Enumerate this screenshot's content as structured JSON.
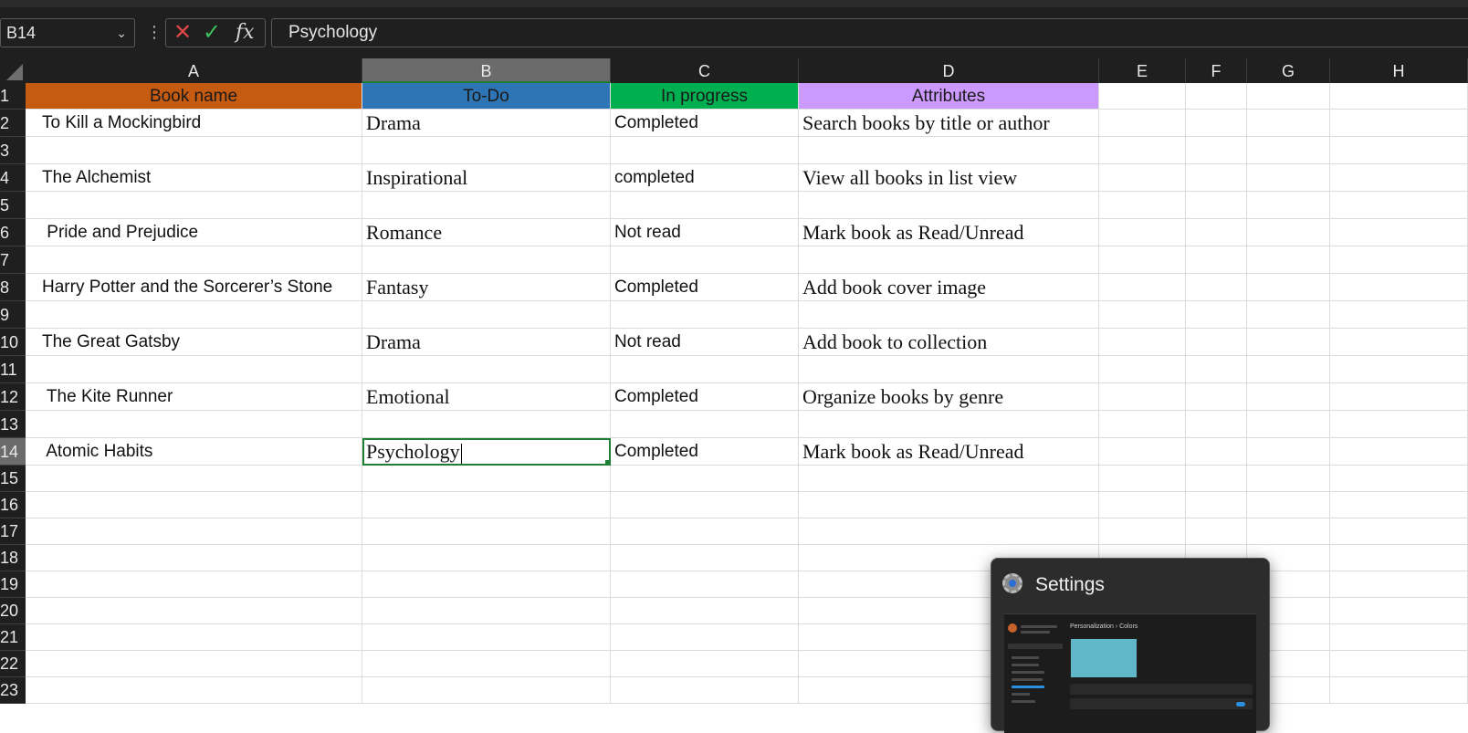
{
  "formula_bar": {
    "name_box": "B14",
    "formula": "Psychology",
    "cancel_icon": "x-icon",
    "enter_icon": "check-icon",
    "function_label": "fx"
  },
  "columns": [
    "A",
    "B",
    "C",
    "D",
    "E",
    "F",
    "G",
    "H"
  ],
  "rows": [
    "1",
    "2",
    "3",
    "4",
    "5",
    "6",
    "7",
    "8",
    "9",
    "10",
    "11",
    "12",
    "13",
    "14",
    "15",
    "16",
    "17",
    "18",
    "19",
    "20",
    "21",
    "22",
    "23"
  ],
  "headers": {
    "a": "Book name",
    "b": "To-Do",
    "c": "In progress",
    "d": "Attributes"
  },
  "header_colors": {
    "a": "#c55a11",
    "b": "#2e75b6",
    "c": "#00b050",
    "d": "#cc99ff"
  },
  "books": [
    {
      "name": "To Kill a Mockingbird",
      "genre": "Drama",
      "status": "Completed",
      "attribute": "Search books by title or author"
    },
    {
      "name": "The Alchemist",
      "genre": "Inspirational",
      "status": "completed",
      "attribute": "View all books in list view"
    },
    {
      "name": " Pride and Prejudice",
      "genre": "Romance",
      "status": "Not read",
      "attribute": "Mark book as Read/Unread"
    },
    {
      "name": "Harry Potter and the Sorcerer’s Stone",
      "genre": "Fantasy",
      "status": "Completed",
      "attribute": "Add book cover image"
    },
    {
      "name": "The Great Gatsby",
      "genre": "Drama",
      "status": "Not read",
      "attribute": "Add book to collection"
    },
    {
      "name": " The Kite Runner",
      "genre": "Emotional",
      "status": "Completed",
      "attribute": "Organize books by genre"
    },
    {
      "name": " Atomic Habits",
      "genre": "Psychology",
      "status": "Completed",
      "attribute": "Mark book as Read/Unread"
    }
  ],
  "active_cell": "B14",
  "preview": {
    "title": "Settings",
    "icon": "gear-icon",
    "thumb_crumb": "Personalization › Colors"
  }
}
